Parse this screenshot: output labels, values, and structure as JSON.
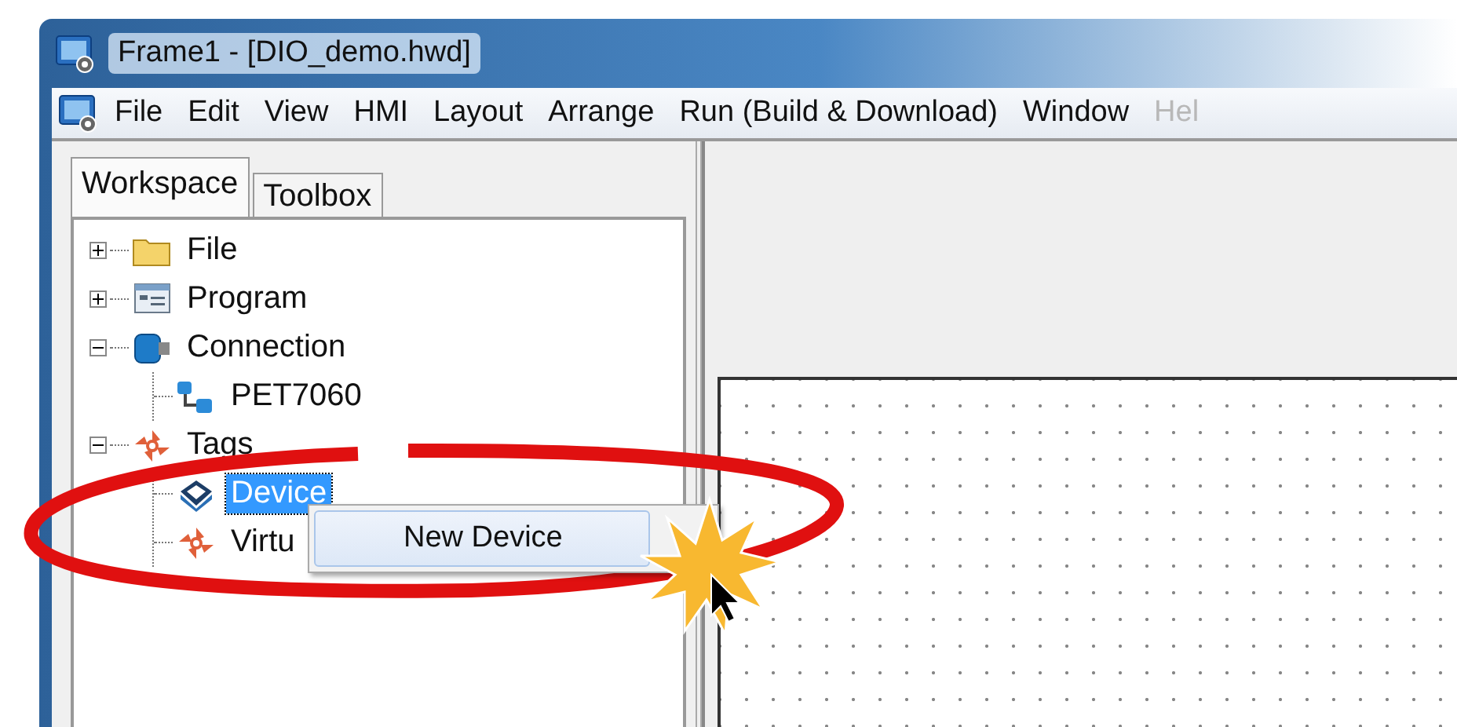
{
  "window": {
    "title": "Frame1 - [DIO_demo.hwd]"
  },
  "menu": [
    {
      "label": "File",
      "disabled": false
    },
    {
      "label": "Edit",
      "disabled": false
    },
    {
      "label": "View",
      "disabled": false
    },
    {
      "label": "HMI",
      "disabled": false
    },
    {
      "label": "Layout",
      "disabled": false
    },
    {
      "label": "Arrange",
      "disabled": false
    },
    {
      "label": "Run (Build & Download)",
      "disabled": false
    },
    {
      "label": "Window",
      "disabled": false
    },
    {
      "label": "Hel",
      "disabled": true
    }
  ],
  "tabs": [
    {
      "label": "Workspace",
      "selected": true
    },
    {
      "label": "Toolbox",
      "selected": false
    }
  ],
  "tree": [
    {
      "label": "File",
      "expanded": false,
      "selected": false
    },
    {
      "label": "Program",
      "expanded": false,
      "selected": false
    },
    {
      "label": "Connection",
      "expanded": true,
      "selected": false,
      "children": [
        {
          "label": "PET7060",
          "selected": false
        }
      ]
    },
    {
      "label": "Tags",
      "expanded": true,
      "selected": false,
      "children": [
        {
          "label": "Device",
          "selected": true
        },
        {
          "label": "Virtu",
          "selected": false
        }
      ]
    }
  ],
  "context_menu": {
    "items": [
      "New Device"
    ]
  }
}
